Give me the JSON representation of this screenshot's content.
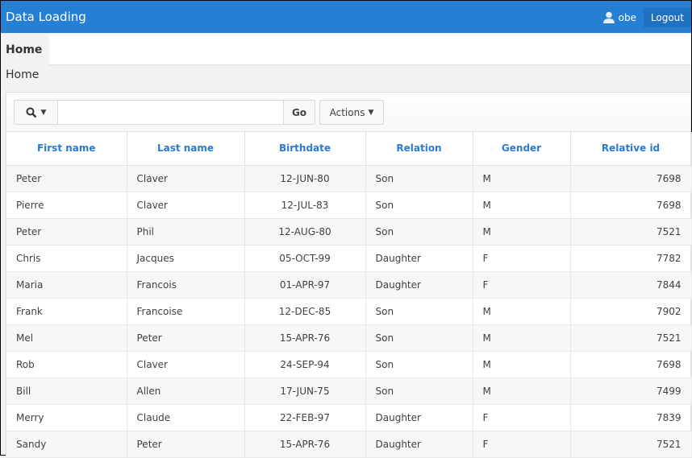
{
  "header": {
    "title": "Data Loading",
    "user": "obe",
    "logout": "Logout"
  },
  "tabs": [
    {
      "label": "Home"
    }
  ],
  "breadcrumb": "Home",
  "toolbar": {
    "search_value": "",
    "go": "Go",
    "actions": "Actions"
  },
  "table": {
    "columns": [
      "First name",
      "Last name",
      "Birthdate",
      "Relation",
      "Gender",
      "Relative id"
    ],
    "rows": [
      [
        "Peter",
        "Claver",
        "12-JUN-80",
        "Son",
        "M",
        "7698"
      ],
      [
        "Pierre",
        "Claver",
        "12-JUL-83",
        "Son",
        "M",
        "7698"
      ],
      [
        "Peter",
        "Phil",
        "12-AUG-80",
        "Son",
        "M",
        "7521"
      ],
      [
        "Chris",
        "Jacques",
        "05-OCT-99",
        "Daughter",
        "F",
        "7782"
      ],
      [
        "Maria",
        "Francois",
        "01-APR-97",
        "Daughter",
        "F",
        "7844"
      ],
      [
        "Frank",
        "Francoise",
        "12-DEC-85",
        "Son",
        "M",
        "7902"
      ],
      [
        "Mel",
        "Peter",
        "15-APR-76",
        "Son",
        "M",
        "7521"
      ],
      [
        "Rob",
        "Claver",
        "24-SEP-94",
        "Son",
        "M",
        "7698"
      ],
      [
        "Bill",
        "Allen",
        "17-JUN-75",
        "Son",
        "M",
        "7499"
      ],
      [
        "Merry",
        "Claude",
        "22-FEB-97",
        "Daughter",
        "F",
        "7839"
      ],
      [
        "Sandy",
        "Peter",
        "15-APR-76",
        "Daughter",
        "F",
        "7521"
      ]
    ]
  }
}
